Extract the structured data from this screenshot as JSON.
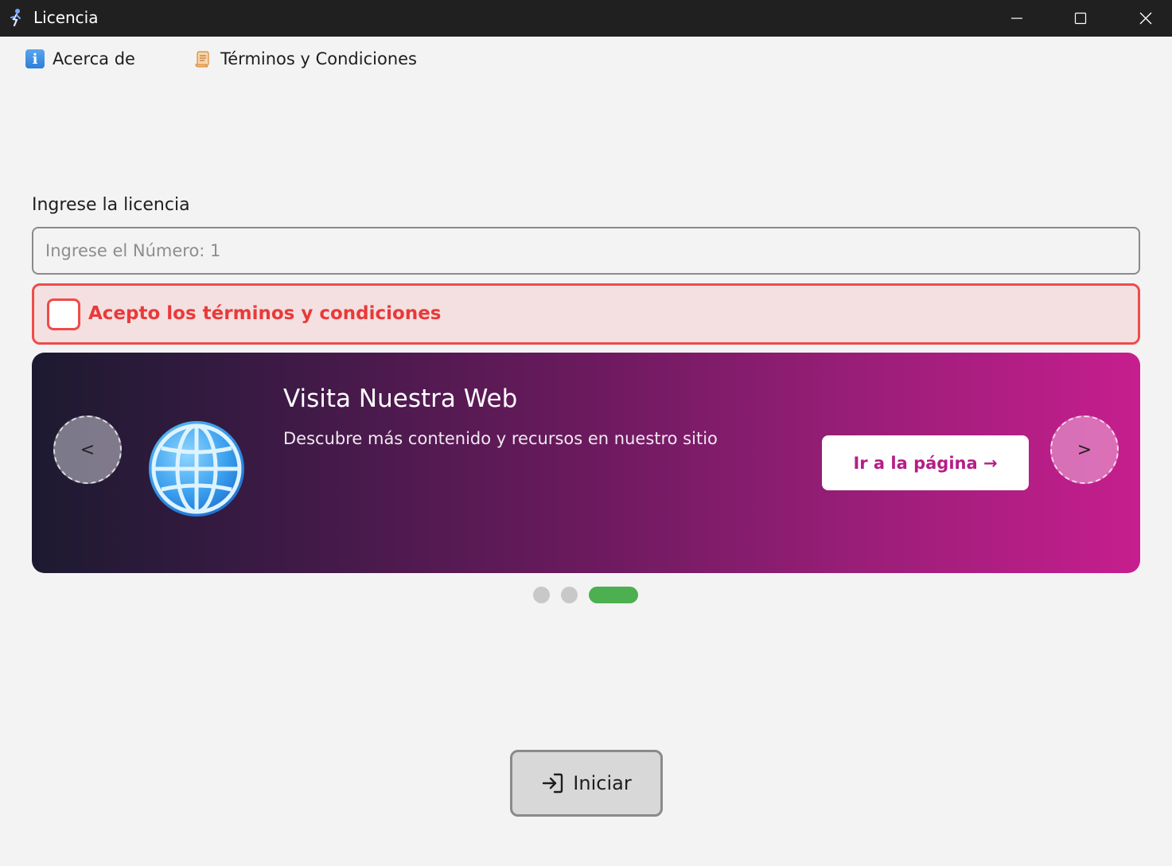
{
  "window": {
    "title": "Licencia",
    "controls": [
      "minimize",
      "maximize",
      "close"
    ]
  },
  "menu": {
    "items": [
      {
        "label": "Acerca de",
        "icon": "info-icon"
      },
      {
        "label": "Términos y Condiciones",
        "icon": "scroll-icon"
      }
    ]
  },
  "license": {
    "label": "Ingrese la licencia",
    "placeholder": "Ingrese el Número: 1",
    "value": ""
  },
  "terms": {
    "label": "Acepto los términos y condiciones",
    "checked": false,
    "accent_color": "#ef4b4b"
  },
  "carousel": {
    "title": "Visita Nuestra Web",
    "subtitle": "Descubre más contenido y recursos en nuestro sitio",
    "cta_label": "Ir a la página →",
    "prev_label": "<",
    "next_label": ">",
    "icon": "globe-icon",
    "slide_count": 3,
    "active_slide": 3,
    "active_dot_color": "#4caf50"
  },
  "actions": {
    "start_label": "Iniciar",
    "start_icon": "login-icon"
  }
}
